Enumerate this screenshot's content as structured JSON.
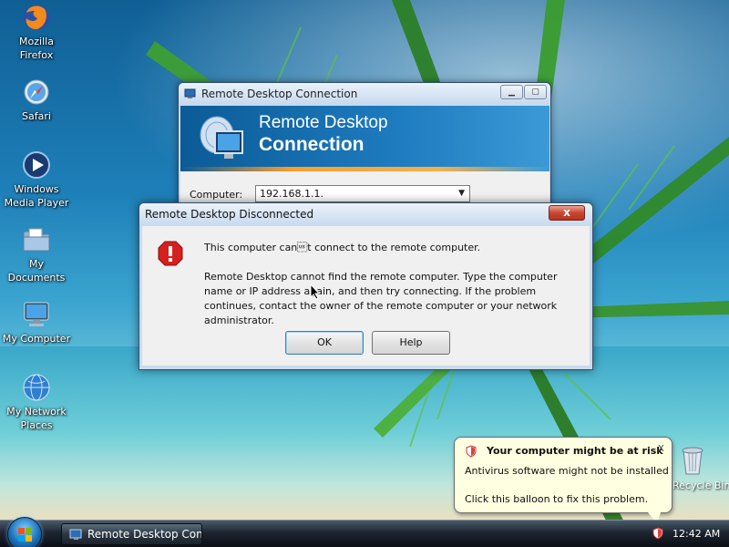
{
  "desktop": {
    "icons": [
      {
        "name": "firefox",
        "label": "Mozilla Firefox"
      },
      {
        "name": "safari",
        "label": "Safari"
      },
      {
        "name": "media-player",
        "label": "Windows Media Player"
      },
      {
        "name": "my-documents",
        "label": "My Documents"
      },
      {
        "name": "my-computer",
        "label": "My Computer"
      },
      {
        "name": "my-network-places",
        "label": "My Network Places"
      }
    ],
    "recycle_bin_label": "Recycle Bin"
  },
  "rdc_window": {
    "title": "Remote Desktop Connection",
    "banner_line1": "Remote Desktop",
    "banner_line2": "Connection",
    "computer_label": "Computer:",
    "computer_value": "192.168.1.1."
  },
  "error_dialog": {
    "title": "Remote Desktop Disconnected",
    "close_symbol": "x",
    "message_short": "This computer can\u001ft connect to the remote computer.",
    "message_long": "Remote Desktop cannot find the remote computer. Type the computer name or IP address again, and then try connecting. If the problem continues, contact the owner of the remote computer or your network administrator.",
    "ok_label": "OK",
    "help_label": "Help"
  },
  "balloon": {
    "title": "Your computer might be at risk",
    "close_symbol": "x",
    "line1": "Antivirus software might not be installed",
    "line2": "Click this balloon to fix this problem."
  },
  "taskbar": {
    "task_label": "Remote Desktop Con...",
    "clock": "12:42 AM"
  },
  "colors": {
    "banner_blue": "#1e7cc0",
    "banner_orange": "#f6a02c",
    "error_red": "#d62020",
    "balloon_bg": "#ffffe1"
  }
}
